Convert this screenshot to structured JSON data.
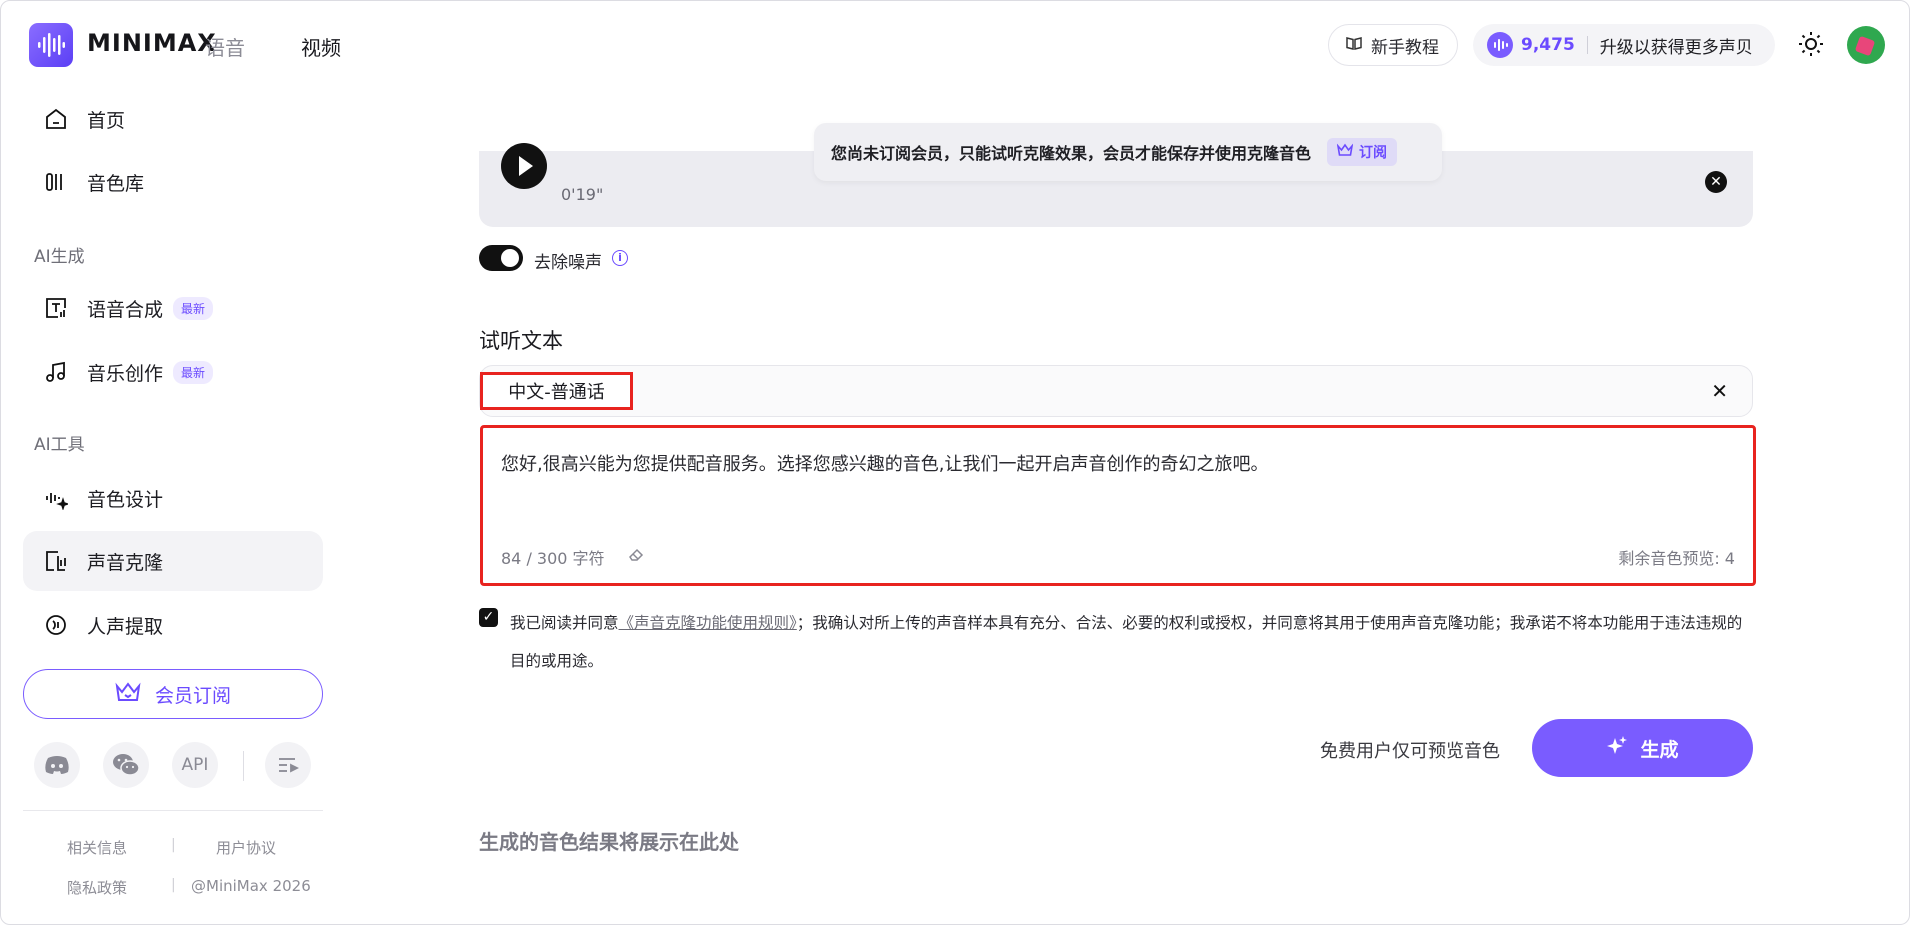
{
  "header": {
    "brand": "MINIMAX",
    "nav_voice": "语音",
    "nav_video": "视频",
    "tutorial_label": "新手教程",
    "credits_value": "9,475",
    "upgrade_label": "升级以获得更多声贝"
  },
  "sidebar": {
    "items": [
      {
        "label": "首页"
      },
      {
        "label": "音色库"
      },
      {
        "label": "语音合成",
        "badge": "最新"
      },
      {
        "label": "音乐创作",
        "badge": "最新"
      },
      {
        "label": "音色设计"
      },
      {
        "label": "声音克隆"
      },
      {
        "label": "人声提取"
      }
    ],
    "section_ai_generate": "AI生成",
    "section_ai_tools": "AI工具",
    "member_button": "会员订阅",
    "api_label": "API",
    "footer": {
      "related": "相关信息",
      "user_agreement": "用户协议",
      "privacy": "隐私政策",
      "copyright": "@MiniMax 2026"
    }
  },
  "main": {
    "toast_text": "您尚未订阅会员，只能试听克隆效果，会员才能保存并使用克隆音色",
    "toast_button": "订阅",
    "audio_duration": "0'19\"",
    "denoise_label": "去除噪声",
    "preview_title": "试听文本",
    "language": "中文-普通话",
    "preview_text": "您好,很高兴能为您提供配音服务。选择您感兴趣的音色,让我们一起开启声音创作的奇幻之旅吧。",
    "char_count": "84 / 300 字符",
    "remaining_previews": "剩余音色预览: 4",
    "agree_prefix": "我已阅读并同意",
    "agree_link": "《声音克隆功能使用规则》",
    "agree_rest": "；我确认对所上传的声音样本具有充分、合法、必要的权利或授权，并同意将其用于使用声音克隆功能；我承诺不将本功能用于违法违规的目的或用途。",
    "free_note": "免费用户仅可预览音色",
    "generate_button": "生成",
    "result_placeholder": "生成的音色结果将展示在此处"
  },
  "colors": {
    "accent": "#7a5cff",
    "highlight_border": "#e8231f"
  }
}
